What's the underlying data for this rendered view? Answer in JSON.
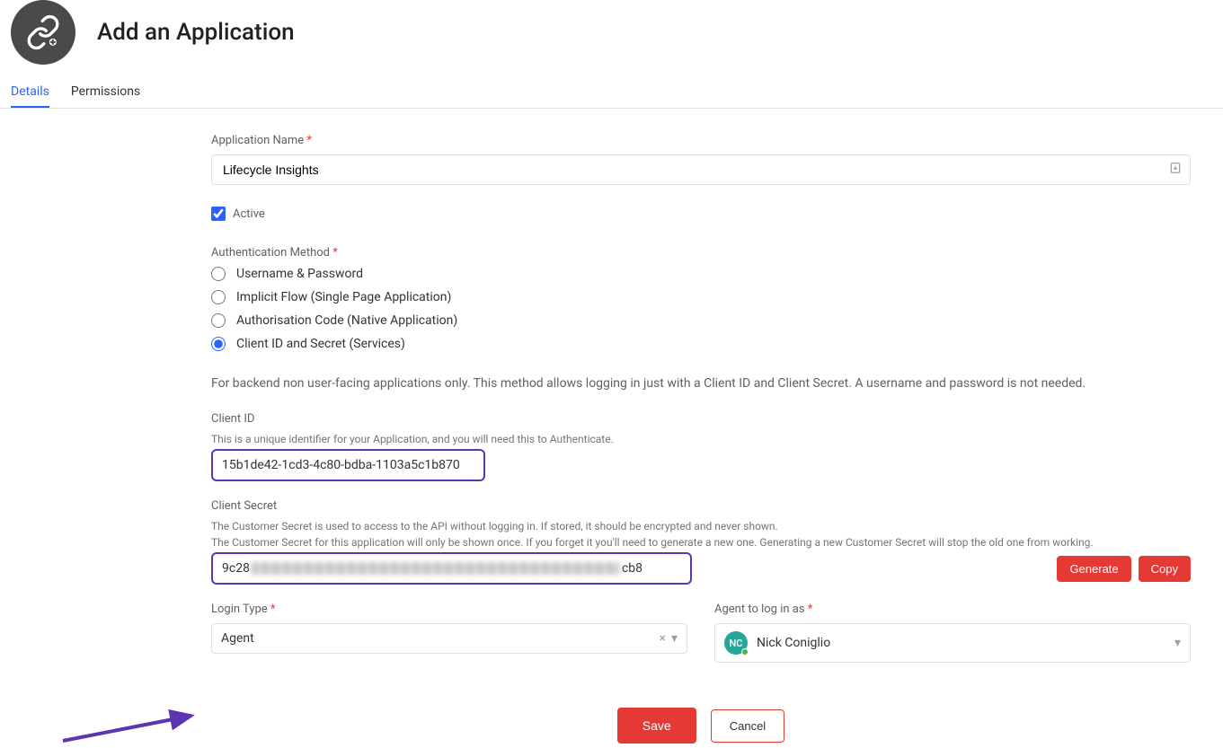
{
  "header": {
    "title": "Add an Application"
  },
  "tabs": [
    {
      "label": "Details",
      "active": true
    },
    {
      "label": "Permissions",
      "active": false
    }
  ],
  "form": {
    "appName": {
      "label": "Application Name",
      "value": "Lifecycle Insights"
    },
    "active": {
      "label": "Active",
      "checked": true
    },
    "authMethod": {
      "label": "Authentication Method",
      "options": [
        {
          "label": "Username & Password",
          "selected": false
        },
        {
          "label": "Implicit Flow (Single Page Application)",
          "selected": false
        },
        {
          "label": "Authorisation Code (Native Application)",
          "selected": false
        },
        {
          "label": "Client ID and Secret (Services)",
          "selected": true
        }
      ],
      "helpText": "For backend non user-facing applications only. This method allows logging in just with a Client ID and Client Secret. A username and password is not needed."
    },
    "clientId": {
      "label": "Client ID",
      "hint": "This is a unique identifier for your Application, and you will need this to Authenticate.",
      "value": "15b1de42-1cd3-4c80-bdba-1103a5c1b870"
    },
    "clientSecret": {
      "label": "Client Secret",
      "hint1": "The Customer Secret is used to access to the API without logging in. If stored, it should be encrypted and never shown.",
      "hint2": "The Customer Secret for this application will only be shown once. If you forget it you'll need to generate a new one. Generating a new Customer Secret will stop the old one from working.",
      "valuePrefix": "9c28",
      "valueSuffix": "cb8",
      "generateBtn": "Generate",
      "copyBtn": "Copy"
    },
    "loginType": {
      "label": "Login Type",
      "value": "Agent"
    },
    "agentLogin": {
      "label": "Agent to log in as",
      "avatarInitials": "NC",
      "name": "Nick Coniglio"
    },
    "actions": {
      "save": "Save",
      "cancel": "Cancel"
    }
  }
}
